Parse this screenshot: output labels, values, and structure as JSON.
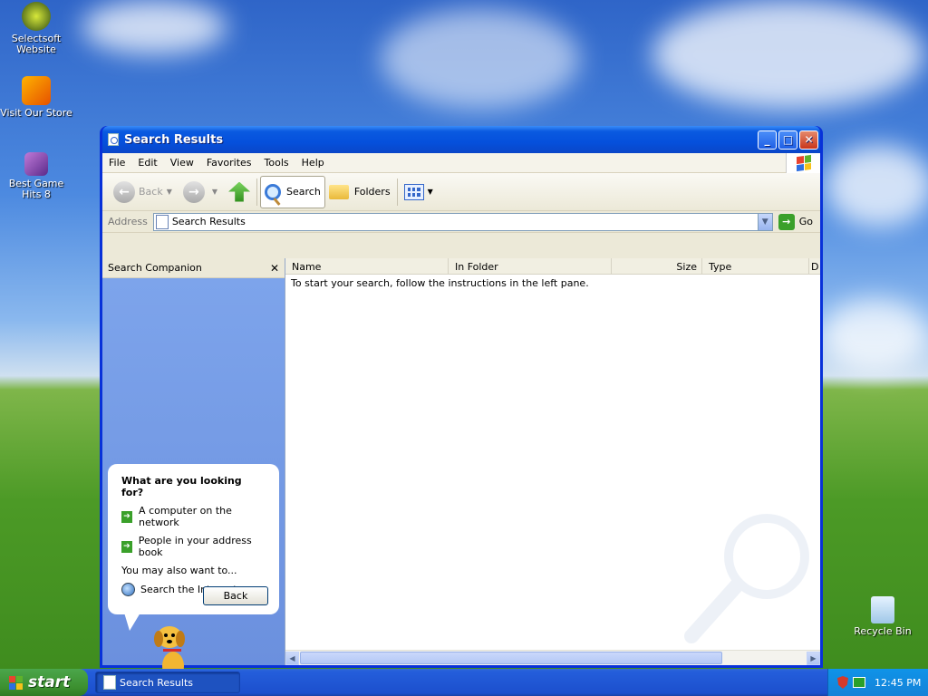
{
  "desktop": {
    "icons": [
      {
        "label": "Selectsoft Website"
      },
      {
        "label": "Visit Our Store"
      },
      {
        "label": "Best Game Hits 8"
      },
      {
        "label": "Recycle Bin"
      }
    ]
  },
  "window": {
    "title": "Search Results",
    "menu": [
      "File",
      "Edit",
      "View",
      "Favorites",
      "Tools",
      "Help"
    ],
    "toolbar": {
      "back": "Back",
      "search": "Search",
      "folders": "Folders"
    },
    "address": {
      "label": "Address",
      "value": "Search Results",
      "go": "Go"
    },
    "left_pane": {
      "header": "Search Companion",
      "balloon_title": "What are you looking for?",
      "options": [
        "A computer on the network",
        "People in your address book"
      ],
      "also_label": "You may also want to...",
      "internet_option": "Search the Internet",
      "back_button": "Back"
    },
    "columns": [
      "Name",
      "In Folder",
      "Size",
      "Type",
      "D"
    ],
    "message": "To start your search, follow the instructions in the left pane."
  },
  "taskbar": {
    "start_label": "start",
    "task_label": "Search Results",
    "clock": "12:45 PM"
  },
  "colors": {
    "titlebar": "#0550dc",
    "taskbar": "#245edb",
    "start": "#3c8f2f",
    "companion_pane": "#7ea5ec"
  }
}
